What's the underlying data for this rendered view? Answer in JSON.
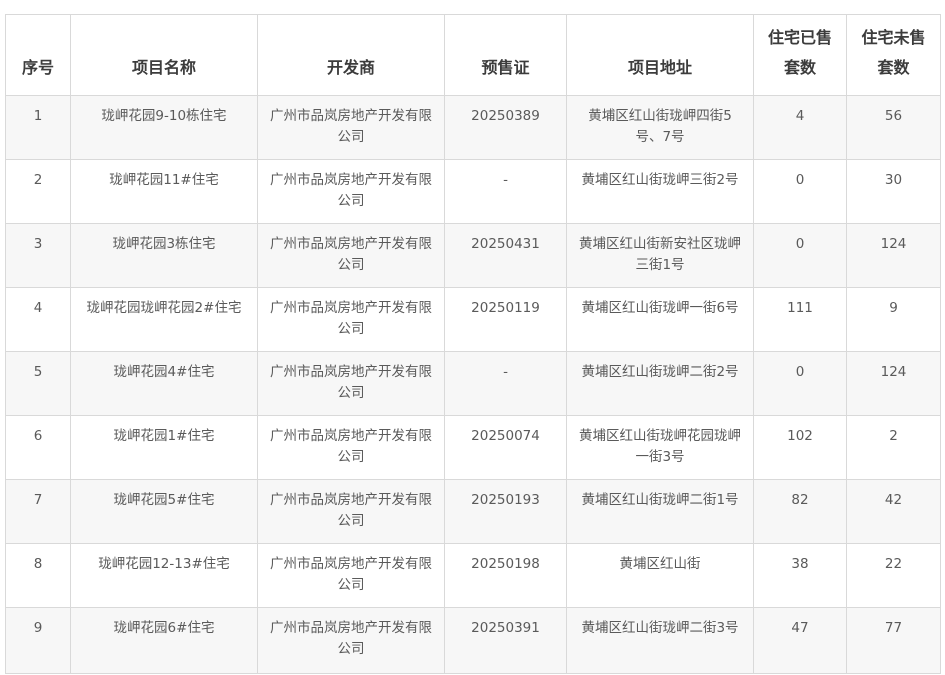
{
  "table": {
    "headers": [
      "序号",
      "项目名称",
      "开发商",
      "预售证",
      "项目地址",
      "住宅已售套数",
      "住宅未售套数"
    ],
    "rows": [
      [
        "1",
        "珑岬花园9-10栋住宅",
        "广州市品岚房地产开发有限公司",
        "20250389",
        "黄埔区红山街珑岬四街5号、7号",
        "4",
        "56"
      ],
      [
        "2",
        "珑岬花园11#住宅",
        "广州市品岚房地产开发有限公司",
        "-",
        "黄埔区红山街珑岬三街2号",
        "0",
        "30"
      ],
      [
        "3",
        "珑岬花园3栋住宅",
        "广州市品岚房地产开发有限公司",
        "20250431",
        "黄埔区红山街新安社区珑岬三街1号",
        "0",
        "124"
      ],
      [
        "4",
        "珑岬花园珑岬花园2#住宅",
        "广州市品岚房地产开发有限公司",
        "20250119",
        "黄埔区红山街珑岬一街6号",
        "111",
        "9"
      ],
      [
        "5",
        "珑岬花园4#住宅",
        "广州市品岚房地产开发有限公司",
        "-",
        "黄埔区红山街珑岬二街2号",
        "0",
        "124"
      ],
      [
        "6",
        "珑岬花园1#住宅",
        "广州市品岚房地产开发有限公司",
        "20250074",
        "黄埔区红山街珑岬花园珑岬一街3号",
        "102",
        "2"
      ],
      [
        "7",
        "珑岬花园5#住宅",
        "广州市品岚房地产开发有限公司",
        "20250193",
        "黄埔区红山街珑岬二街1号",
        "82",
        "42"
      ],
      [
        "8",
        "珑岬花园12-13#住宅",
        "广州市品岚房地产开发有限公司",
        "20250198",
        "黄埔区红山街",
        "38",
        "22"
      ],
      [
        "9",
        "珑岬花园6#住宅",
        "广州市品岚房地产开发有限公司",
        "20250391",
        "黄埔区红山街珑岬二街3号",
        "47",
        "77"
      ]
    ]
  }
}
